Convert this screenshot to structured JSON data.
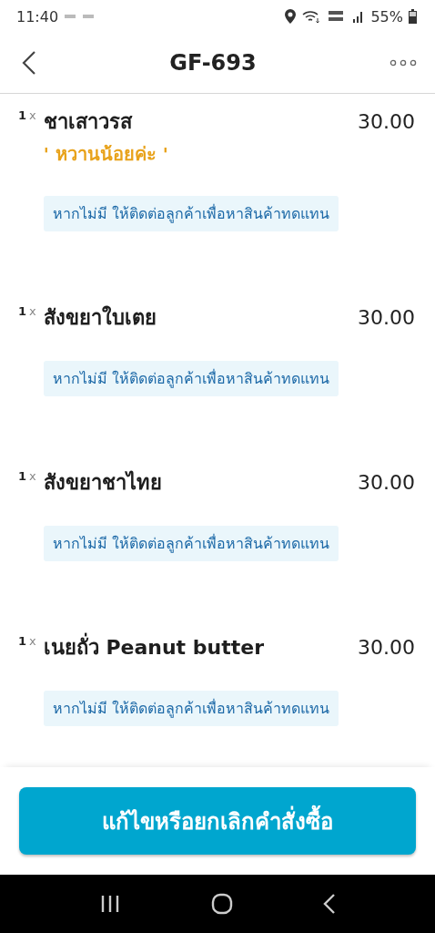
{
  "status_bar": {
    "time": "11:40",
    "battery": "55%"
  },
  "header": {
    "title": "GF-693"
  },
  "items": [
    {
      "quantity": "1",
      "multiplier": "x",
      "name": "ชาเสาวรส",
      "price": "30.00",
      "note": "' หวานน้อยค่ะ '",
      "substitution": "หากไม่มี ให้ติดต่อลูกค้าเพื่อหาสินค้าทดแทน"
    },
    {
      "quantity": "1",
      "multiplier": "x",
      "name": "สังขยาใบเตย",
      "price": "30.00",
      "substitution": "หากไม่มี ให้ติดต่อลูกค้าเพื่อหาสินค้าทดแทน"
    },
    {
      "quantity": "1",
      "multiplier": "x",
      "name": "สังขยาชาไทย",
      "price": "30.00",
      "substitution": "หากไม่มี ให้ติดต่อลูกค้าเพื่อหาสินค้าทดแทน"
    },
    {
      "quantity": "1",
      "multiplier": "x",
      "name": "เนยถั่ว Peanut butter",
      "price": "30.00",
      "substitution": "หากไม่มี ให้ติดต่อลูกค้าเพื่อหาสินค้าทดแทน"
    }
  ],
  "action_button": "แก้ไขหรือยกเลิกคำสั่งซื้อ"
}
